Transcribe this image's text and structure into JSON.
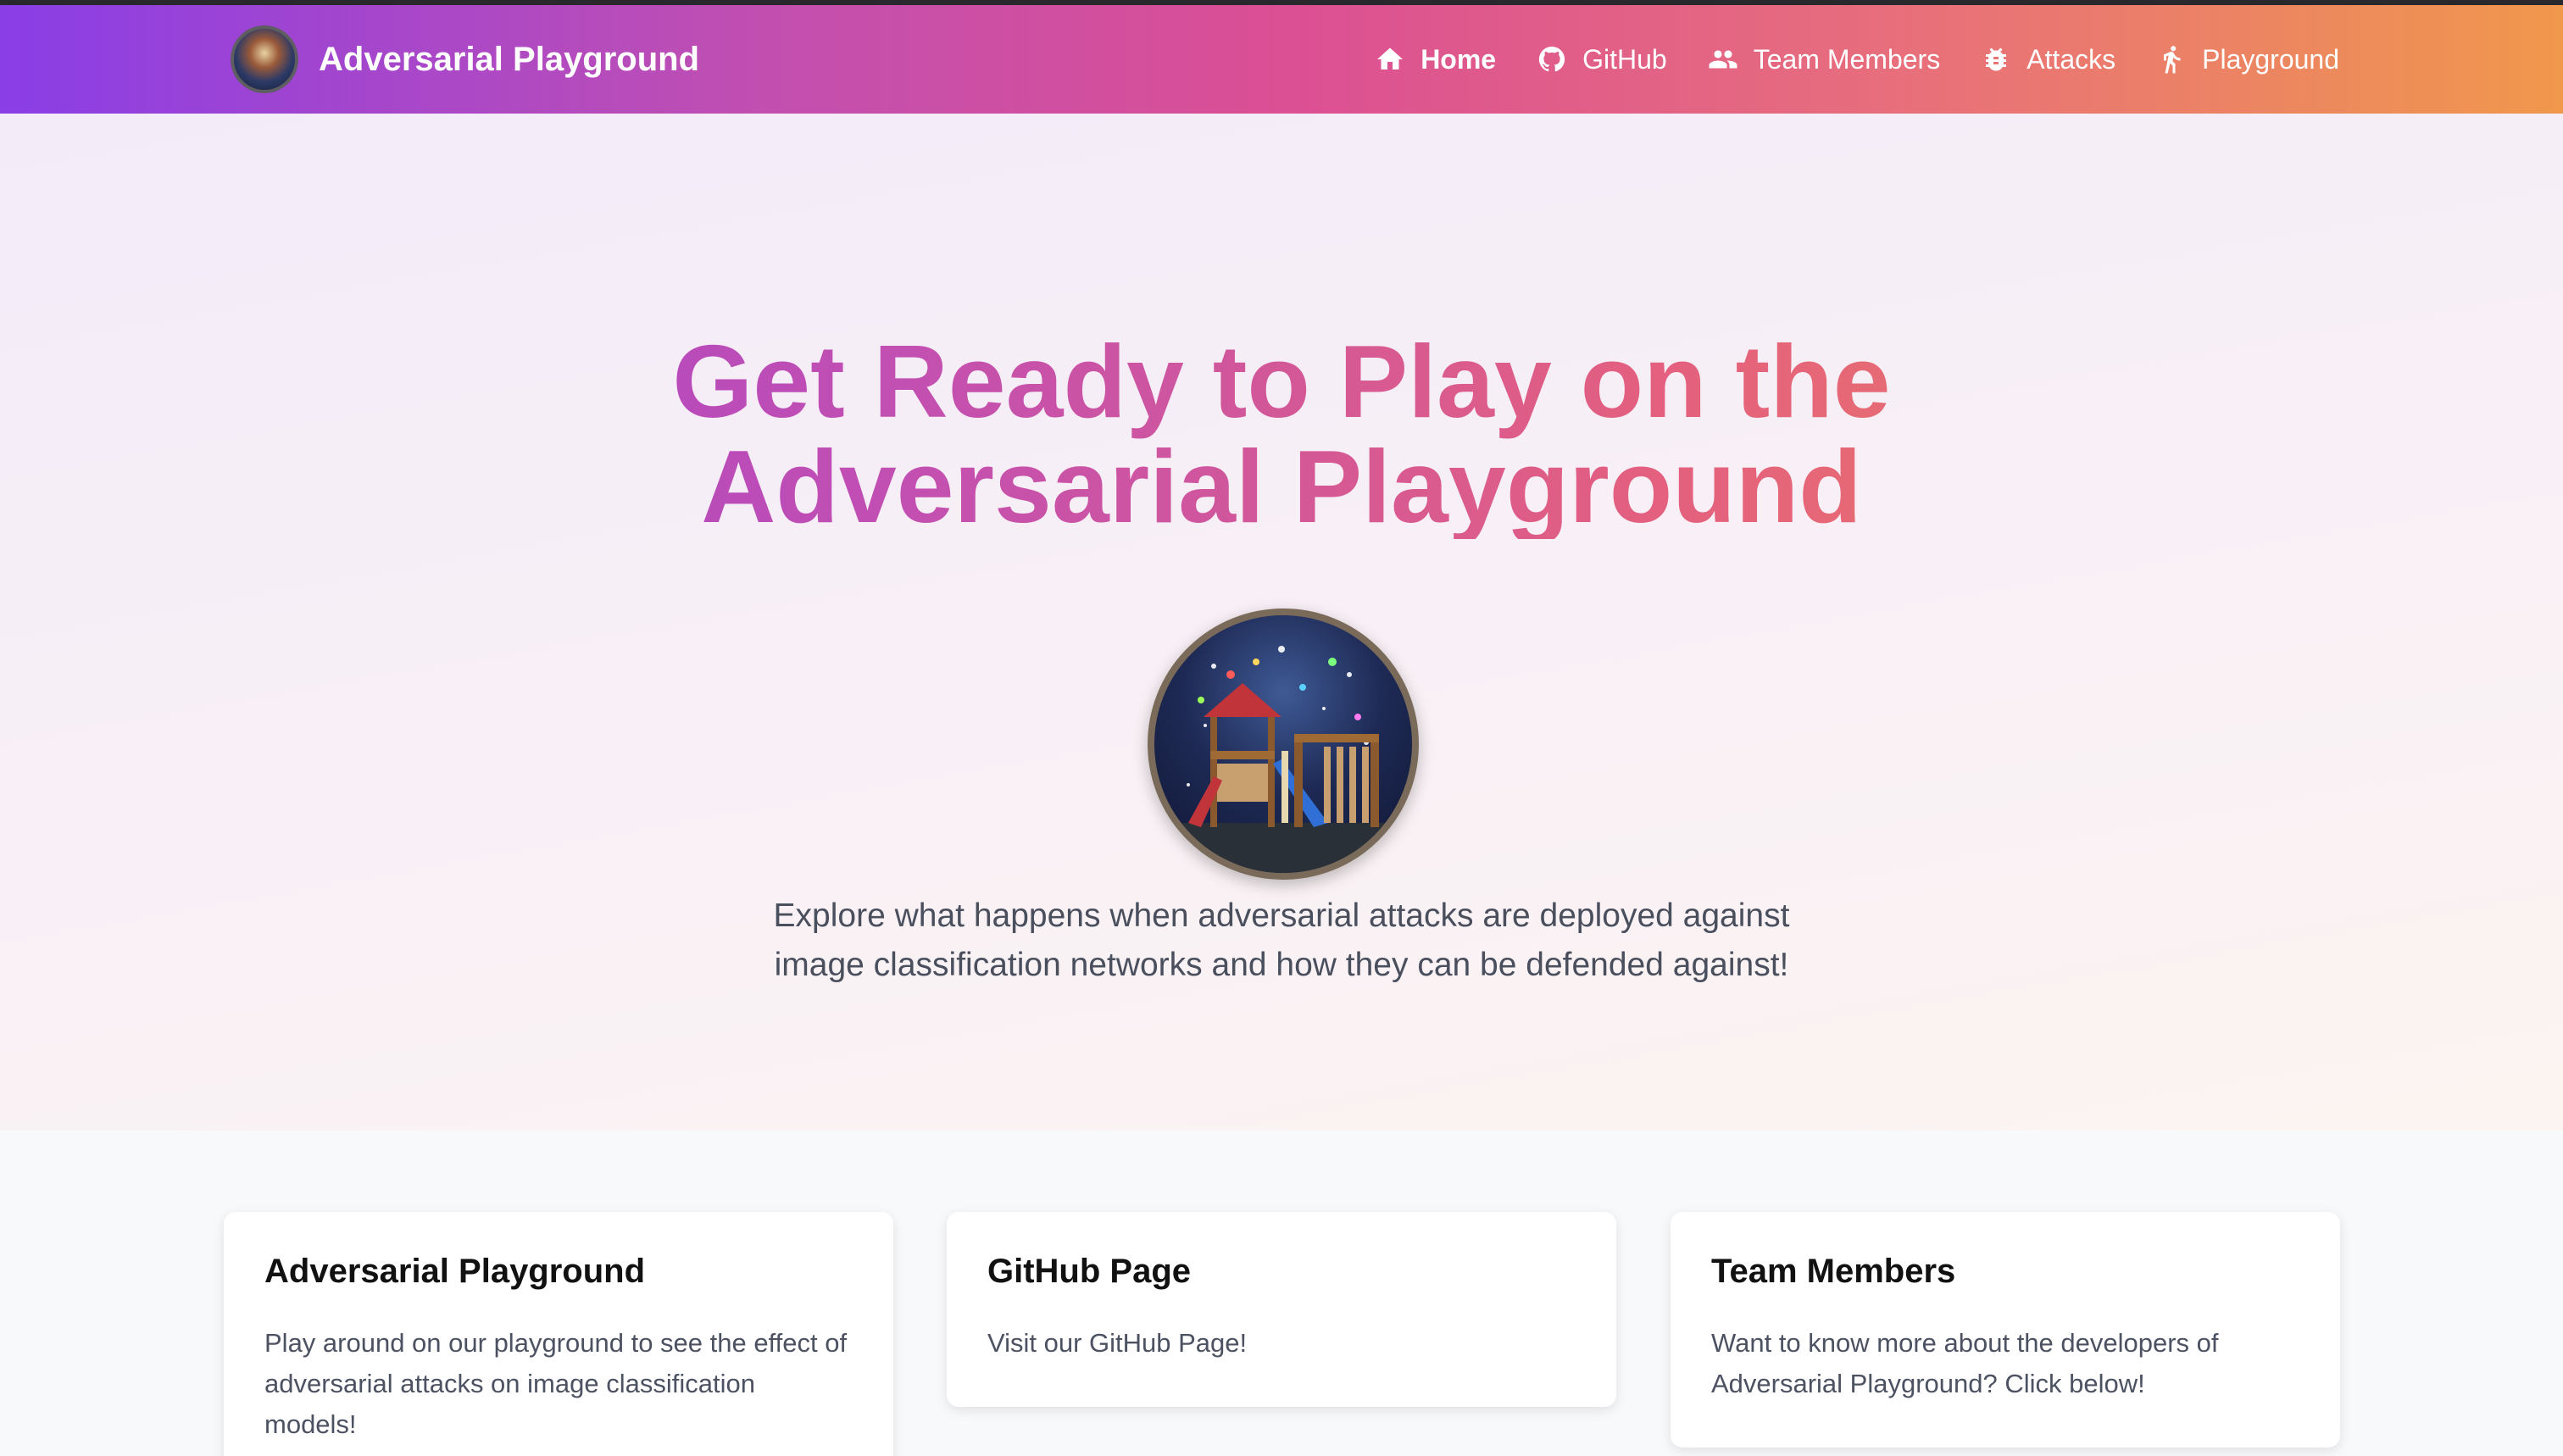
{
  "nav": {
    "brand": "Adversarial Playground",
    "links": [
      {
        "label": "Home",
        "icon": "home-icon",
        "active": true
      },
      {
        "label": "GitHub",
        "icon": "github-icon",
        "active": false
      },
      {
        "label": "Team Members",
        "icon": "people-icon",
        "active": false
      },
      {
        "label": "Attacks",
        "icon": "bug-icon",
        "active": false
      },
      {
        "label": "Playground",
        "icon": "running-person-icon",
        "active": false
      }
    ]
  },
  "hero": {
    "title_line1": "Get Ready to Play on the",
    "title_line2": "Adversarial Playground",
    "description": "Explore what happens when adversarial attacks are deployed against image classification networks and how they can be defended against!"
  },
  "cards": [
    {
      "title": "Adversarial Playground",
      "text": "Play around on our playground to see the effect of adversarial attacks on image classification models!"
    },
    {
      "title": "GitHub Page",
      "text": "Visit our GitHub Page!"
    },
    {
      "title": "Team Members",
      "text": "Want to know more about the developers of Adversarial Playground? Click below!"
    }
  ],
  "colors": {
    "gradient_start": "#8a3ee6",
    "gradient_mid": "#db4f94",
    "gradient_end": "#f0984c"
  }
}
